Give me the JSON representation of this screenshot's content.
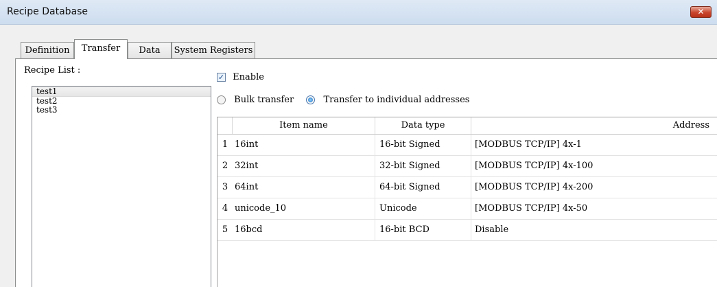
{
  "window": {
    "title": "Recipe Database",
    "close_label": "✕"
  },
  "tabs": [
    {
      "label": "Definition"
    },
    {
      "label": "Transfer",
      "active": true
    },
    {
      "label": "Data"
    },
    {
      "label": "System Registers"
    }
  ],
  "recipe_list": {
    "label": "Recipe List :",
    "items": [
      {
        "label": "test1",
        "selected": true
      },
      {
        "label": "test2"
      },
      {
        "label": "test3"
      }
    ]
  },
  "transfer": {
    "enable_label": "Enable",
    "enable_checked": true,
    "bulk_label": "Bulk transfer",
    "individual_label": "Transfer to individual addresses",
    "selected_mode": "individual"
  },
  "table": {
    "columns": [
      "Item name",
      "Data type",
      "Address"
    ],
    "rows": [
      {
        "num": "1",
        "name": "16int",
        "type": "16-bit Signed",
        "address": "[MODBUS TCP/IP] 4x-1"
      },
      {
        "num": "2",
        "name": "32int",
        "type": "32-bit Signed",
        "address": "[MODBUS TCP/IP] 4x-100"
      },
      {
        "num": "3",
        "name": "64int",
        "type": "64-bit Signed",
        "address": "[MODBUS TCP/IP] 4x-200"
      },
      {
        "num": "4",
        "name": "unicode_10",
        "type": "Unicode",
        "address": "[MODBUS TCP/IP] 4x-50"
      },
      {
        "num": "5",
        "name": "16bcd",
        "type": "16-bit BCD",
        "address": "Disable"
      }
    ]
  }
}
